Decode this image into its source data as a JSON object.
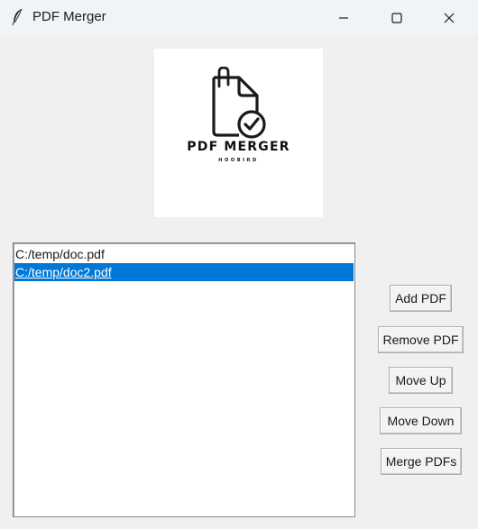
{
  "window": {
    "title": "PDF Merger",
    "app_icon": "feather-icon",
    "controls": {
      "minimize": "minimize-icon",
      "maximize": "maximize-icon",
      "close": "close-icon"
    }
  },
  "logo": {
    "icon": "document-check-icon",
    "title": "PDF MERGER",
    "subtitle": "HOOBIRD"
  },
  "file_list": {
    "items": [
      {
        "path": "C:/temp/doc.pdf",
        "selected": false
      },
      {
        "path": "C:/temp/doc2.pdf",
        "selected": true
      }
    ]
  },
  "buttons": {
    "add": "Add PDF",
    "remove": "Remove PDF",
    "move_up": "Move Up",
    "move_down": "Move Down",
    "merge": "Merge PDFs"
  },
  "colors": {
    "selection": "#0078d7",
    "background": "#f0f0f0",
    "titlebar": "#eef4f7"
  }
}
